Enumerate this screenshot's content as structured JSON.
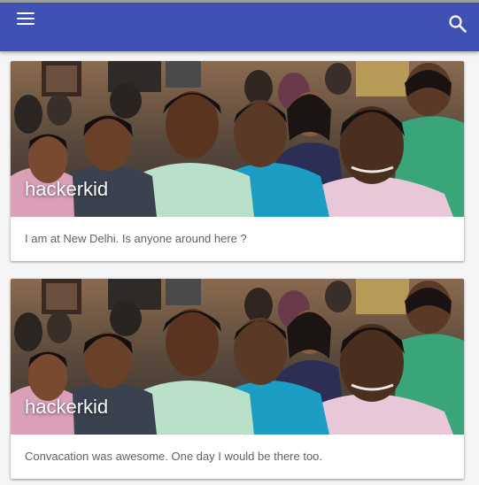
{
  "appbar": {
    "color": "#3f51b5",
    "menu_icon": "hamburger-menu-icon",
    "search_icon": "search-icon"
  },
  "posts": [
    {
      "author": "hackerkid",
      "text": "I am at New Delhi. Is anyone around here ?",
      "image": "group-of-students-photo"
    },
    {
      "author": "hackerkid",
      "text": "Convacation was awesome. One day I would be there too.",
      "image": "group-of-students-photo"
    }
  ]
}
